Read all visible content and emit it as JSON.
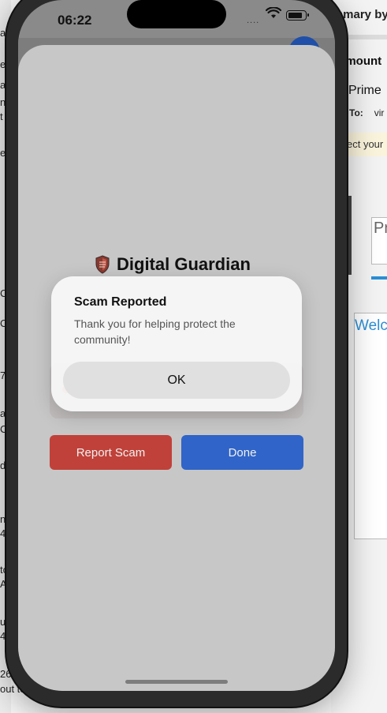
{
  "background_app": {
    "title_fragment": "nmary by",
    "amount_fragment": "amount",
    "prime_fragment": "Prime",
    "to_label": "To:",
    "to_value": "vir",
    "notice_fragment": "ect your",
    "input_fragment": "Pr",
    "welcome_fragment": "Welc",
    "left_fragments": [
      "ar",
      "e",
      "a",
      "n",
      "t",
      "e",
      "C",
      "O",
      "7",
      "a",
      "C",
      "d",
      "n",
      "4",
      "to",
      "A",
      "u",
      "4",
      "26",
      "out to"
    ]
  },
  "status_bar": {
    "time": "06:22",
    "signal": "....",
    "wifi_icon": "wifi-icon",
    "battery_icon": "battery-icon"
  },
  "app": {
    "brand_title": "Digital Guardian",
    "brand_icon": "shield-icon",
    "report_button": "Report Scam",
    "done_button": "Done"
  },
  "alert": {
    "title": "Scam Reported",
    "message": "Thank you for helping protect the community!",
    "ok_button": "OK"
  },
  "colors": {
    "report": "#c0413a",
    "done": "#3064c8",
    "alert_bg": "#f8f8f8"
  }
}
